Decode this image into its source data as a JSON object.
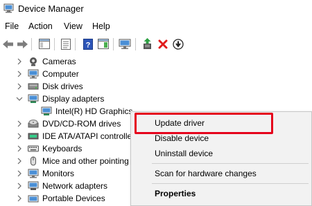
{
  "window": {
    "title": "Device Manager"
  },
  "menu": {
    "file": "File",
    "action": "Action",
    "view": "View",
    "help": "Help"
  },
  "toolbar": {
    "icons": [
      "back-arrow-icon",
      "forward-arrow-icon",
      "show-hide-console-tree-icon",
      "properties-icon",
      "help-icon",
      "action-pane-icon",
      "scan-hardware-icon",
      "update-driver-icon",
      "uninstall-device-icon",
      "disable-device-icon"
    ]
  },
  "tree": {
    "items": [
      {
        "label": "Cameras",
        "expanded": false
      },
      {
        "label": "Computer",
        "expanded": false
      },
      {
        "label": "Disk drives",
        "expanded": false
      },
      {
        "label": "Display adapters",
        "expanded": true
      },
      {
        "label": "Intel(R) HD Graphics",
        "child": true
      },
      {
        "label": "DVD/CD-ROM drives",
        "expanded": false
      },
      {
        "label": "IDE ATA/ATAPI controllers",
        "expanded": false
      },
      {
        "label": "Keyboards",
        "expanded": false
      },
      {
        "label": "Mice and other pointing devices",
        "expanded": false
      },
      {
        "label": "Monitors",
        "expanded": false
      },
      {
        "label": "Network adapters",
        "expanded": false
      },
      {
        "label": "Portable Devices",
        "expanded": false
      }
    ]
  },
  "context_menu": {
    "update_driver": "Update driver",
    "disable_device": "Disable device",
    "uninstall_device": "Uninstall device",
    "scan": "Scan for hardware changes",
    "properties": "Properties"
  },
  "colors": {
    "highlight": "#e5001c",
    "menu_bg": "#f2f2f2"
  }
}
